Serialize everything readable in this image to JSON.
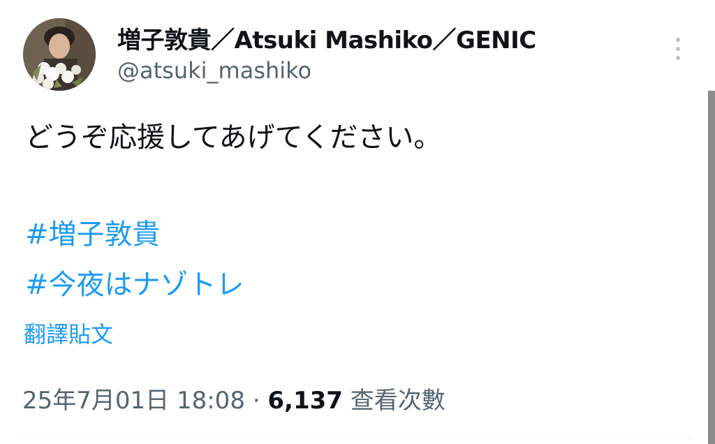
{
  "tweet": {
    "author": {
      "display_name": "増子敦貴／Atsuki Mashiko／GENIC",
      "handle": "@atsuki_mashiko"
    },
    "text": "どうぞ応援してあげてください。",
    "hashtags": [
      "#増子敦貴",
      "#今夜はナゾトレ"
    ],
    "translate_label": "翻譯貼文",
    "timestamp": "25年7月01日 18:08",
    "separator": "·",
    "views_count": "6,137",
    "views_label": "查看次數"
  },
  "icons": {
    "more": "more-vertical-icon",
    "avatar": "profile-avatar"
  },
  "colors": {
    "text_primary": "#0f1419",
    "text_secondary": "#536471",
    "link": "#1d9bf0",
    "menu_dots": "#b9c2c9"
  }
}
